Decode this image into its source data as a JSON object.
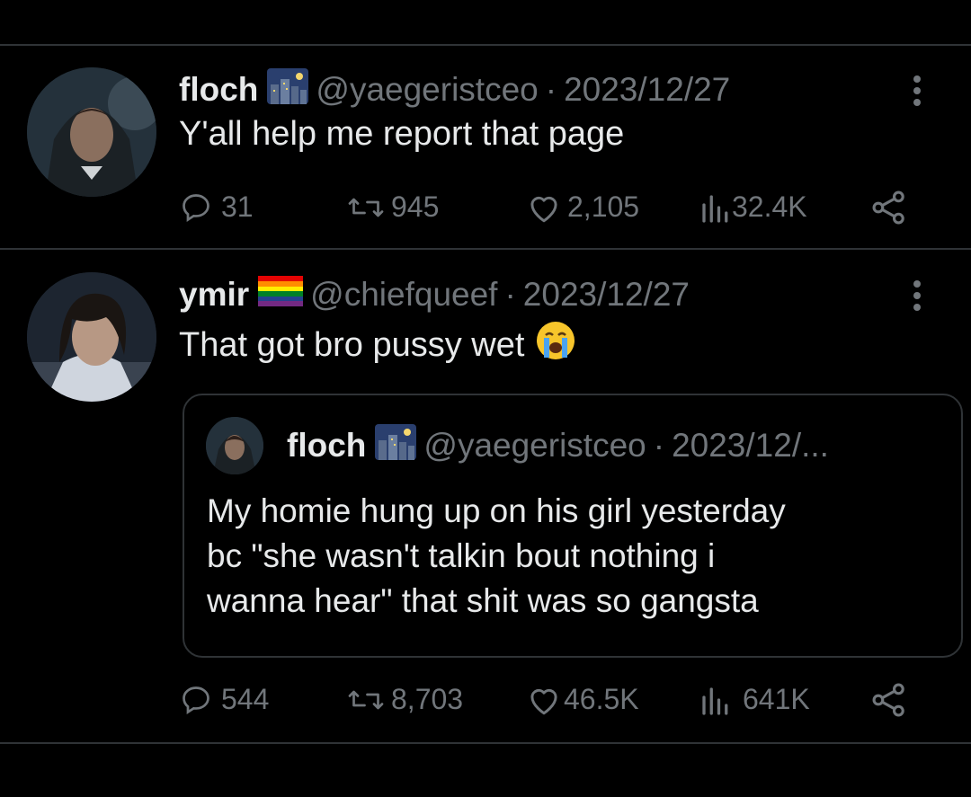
{
  "tweets": [
    {
      "name": "floch",
      "handle": "@yaegeristceo",
      "separator": "·",
      "date": "2023/12/27",
      "text": "Y'all help me report that page",
      "stats": {
        "replies": "31",
        "retweets": "945",
        "likes": "2,105",
        "views": "32.4K"
      }
    },
    {
      "name": "ymir",
      "handle": "@chiefqueef",
      "separator": "·",
      "date": "2023/12/27",
      "text": "That got bro pussy wet",
      "emoji": "😭",
      "quote": {
        "name": "floch",
        "handle": "@yaegeristceo",
        "separator": "·",
        "date": "2023/12/...",
        "lines": [
          "My homie hung up on his girl yesterday",
          "bc \"she wasn't talkin bout nothing i",
          "wanna hear\" that shit was so gangsta"
        ]
      },
      "stats": {
        "replies": "544",
        "retweets": "8,703",
        "likes": "46.5K",
        "views": "641K"
      }
    }
  ],
  "colors": {
    "background": "#000000",
    "text": "#e7e9ea",
    "secondary": "#71767b",
    "border": "#2f3336"
  },
  "icons": [
    "reply-icon",
    "retweet-icon",
    "like-icon",
    "views-icon",
    "share-icon",
    "more-icon",
    "city-night-icon",
    "rainbow-flag-icon"
  ]
}
